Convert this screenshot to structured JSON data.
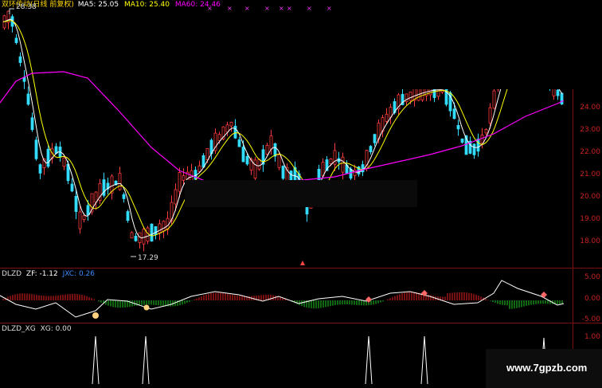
{
  "header": {
    "title": "双环传动(日线 前复权)",
    "ma5": "MA5: 25.05",
    "ma10": "MA10: 25.40",
    "ma60": "MA60: 24.46",
    "colors": {
      "ma5": "#ffffff",
      "ma10": "#ffff00",
      "ma60": "#ff00ff"
    }
  },
  "main_panel": {
    "high_label": "28.38",
    "low_label": "17.29",
    "y_ticks": [
      "24.00",
      "23.00",
      "22.00",
      "21.00",
      "20.00",
      "19.00",
      "18.00"
    ]
  },
  "dlzd_panel": {
    "name": "DLZD",
    "zf": "ZF: -1.12",
    "jxc": "JXC: 0.26",
    "y_ticks": [
      "5.00",
      "0.00",
      "-5.00"
    ]
  },
  "xg_panel": {
    "name": "DLZD_XG",
    "xg": "XG: 0.00",
    "y_ticks": [
      "1.00"
    ]
  },
  "watermark": "www.7gpzb.com",
  "colors": {
    "up": "#ff3b3b",
    "down": "#33ddff",
    "grid": "#7a1010",
    "axis_text": "#cc2222",
    "hist_up": "#ee2222",
    "hist_down": "#22cc22"
  },
  "chart_data": [
    {
      "type": "candlestick",
      "title": "双环传动(日线 前复权)",
      "ylim": [
        17.0,
        25.0
      ],
      "series": [
        {
          "name": "MA5",
          "value": 25.05
        },
        {
          "name": "MA10",
          "value": 25.4
        },
        {
          "name": "MA60",
          "value": 24.46
        }
      ],
      "annotations": [
        {
          "text": "28.38",
          "kind": "high"
        },
        {
          "text": "17.29",
          "kind": "low"
        }
      ]
    },
    {
      "type": "line",
      "title": "DLZD",
      "ylim": [
        -5,
        5
      ],
      "series": [
        {
          "name": "ZF",
          "value": -1.12
        },
        {
          "name": "JXC",
          "value": 0.26
        }
      ]
    },
    {
      "type": "line",
      "title": "DLZD_XG",
      "ylim": [
        0,
        1
      ],
      "series": [
        {
          "name": "XG",
          "value": 0.0
        }
      ]
    }
  ]
}
